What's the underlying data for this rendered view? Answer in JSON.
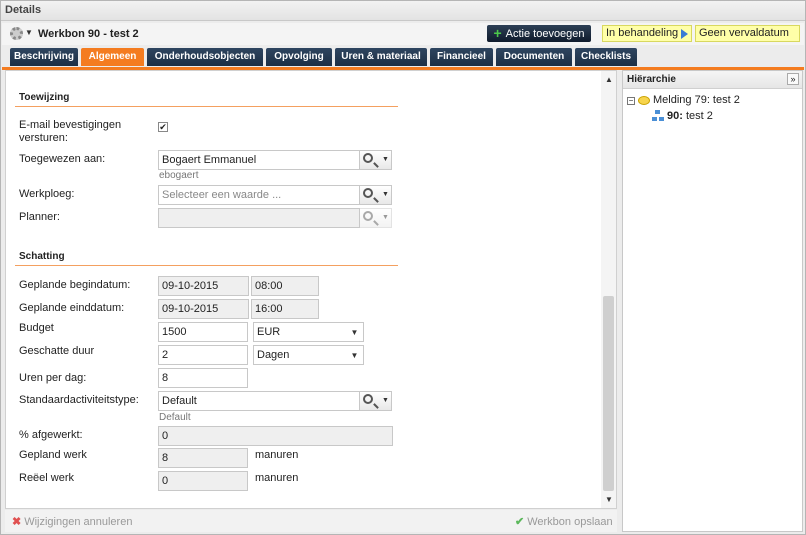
{
  "window": {
    "title": "Details"
  },
  "toolbar": {
    "workbon_title": "Werkbon 90 - test 2",
    "add_action_label": "Actie toevoegen",
    "status_label": "In behandeling",
    "due_label": "Geen vervaldatum"
  },
  "tabs": [
    "Beschrijving",
    "Algemeen",
    "Onderhoudsobjecten",
    "Opvolging",
    "Uren & materiaal",
    "Financieel",
    "Documenten",
    "Checklists"
  ],
  "active_tab": "Algemeen",
  "assignment": {
    "section_title": "Toewijzing",
    "email_label": "E-mail bevestigingen versturen:",
    "email_checked": true,
    "assigned_label": "Toegewezen aan:",
    "assigned_value": "Bogaert Emmanuel",
    "assigned_sub": "ebogaert",
    "team_label": "Werkploeg:",
    "team_placeholder": "Selecteer een waarde ...",
    "planner_label": "Planner:"
  },
  "estimate": {
    "section_title": "Schatting",
    "start_label": "Geplande begindatum:",
    "start_date": "09-10-2015",
    "start_time": "08:00",
    "end_label": "Geplande einddatum:",
    "end_date": "09-10-2015",
    "end_time": "16:00",
    "budget_label": "Budget",
    "budget_value": "1500",
    "currency": "EUR",
    "duration_label": "Geschatte duur",
    "duration_value": "2",
    "duration_unit": "Dagen",
    "hours_label": "Uren per dag:",
    "hours_value": "8",
    "activity_label": "Standaardactiviteitstype:",
    "activity_value": "Default",
    "activity_sub": "Default",
    "percent_label": "% afgewerkt:",
    "percent_value": "0",
    "planned_work_label": "Gepland werk",
    "planned_work_value": "8",
    "planned_work_unit": "manuren",
    "actual_work_label": "Reëel werk",
    "actual_work_value": "0",
    "actual_work_unit": "manuren"
  },
  "footer": {
    "cancel_label": "Wijzigingen annuleren",
    "save_label": "Werkbon opslaan"
  },
  "hierarchy": {
    "title": "Hiërarchie",
    "root_label": "Melding 79: test 2",
    "child_prefix": "90:",
    "child_label": "test 2"
  },
  "colors": {
    "accent": "#f47c20",
    "tab_bg": "#1d2f44",
    "status_bg": "#ffffa8"
  }
}
